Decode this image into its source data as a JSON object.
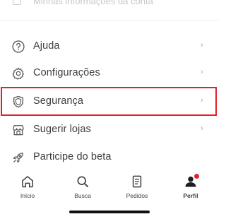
{
  "top_partial": {
    "label": "Minhas informações da conta"
  },
  "menu": [
    {
      "label": "Ajuda",
      "icon": "help-circle-icon"
    },
    {
      "label": "Configurações",
      "icon": "gear-icon"
    },
    {
      "label": "Segurança",
      "icon": "shield-icon",
      "highlighted": true
    },
    {
      "label": "Sugerir lojas",
      "icon": "store-icon"
    },
    {
      "label": "Participe do beta",
      "icon": "rocket-icon"
    }
  ],
  "tabbar": {
    "items": [
      {
        "label": "Início",
        "icon": "home-icon"
      },
      {
        "label": "Busca",
        "icon": "search-icon"
      },
      {
        "label": "Pedidos",
        "icon": "orders-icon"
      },
      {
        "label": "Perfil",
        "icon": "profile-icon",
        "active": true
      }
    ]
  },
  "colors": {
    "highlight": "#e3212c",
    "text": "#3f3e3e",
    "chevron": "#a6a6a6",
    "badge": "#e3212c"
  }
}
